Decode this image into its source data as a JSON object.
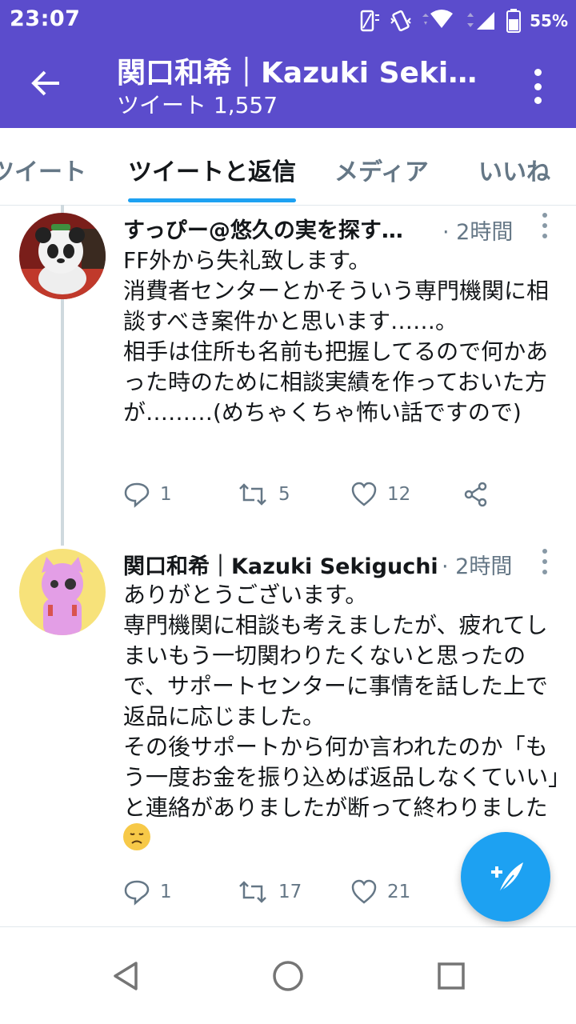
{
  "status_bar": {
    "time": "23:07",
    "battery": "55%"
  },
  "header": {
    "title": "関口和希｜Kazuki Seki…",
    "subtitle": "ツイート 1,557"
  },
  "tabs": [
    {
      "label": "ツイート"
    },
    {
      "label": "ツイートと返信"
    },
    {
      "label": "メディア"
    },
    {
      "label": "いいね"
    }
  ],
  "tweets": [
    {
      "author": "すっぴー@悠久の実を探す…",
      "time": "· 2時間",
      "text": "FF外から失礼致します。\n消費者センターとかそういう専門機関に相談すべき案件かと思います……。\n相手は住所も名前も把握してるので何かあった時のために相談実績を作っておいた方が………(めちゃくちゃ怖い話ですので)",
      "replies": "1",
      "retweets": "5",
      "likes": "12"
    },
    {
      "author": "関口和希｜Kazuki Sekiguchi",
      "time": "· 2時間",
      "text": "ありがとうございます。\n専門機関に相談も考えましたが、疲れてしまいもう一切関わりたくないと思ったので、サポートセンターに事情を話した上で返品に応じました。\nその後サポートから何か言われたのか「もう一度お金を振り込めば返品しなくていい」と連絡がありましたが断って終わりました",
      "replies": "1",
      "retweets": "17",
      "likes": "21"
    }
  ],
  "colors": {
    "header_bg": "#5b4ccc",
    "accent": "#1da1f2",
    "muted": "#657786"
  }
}
